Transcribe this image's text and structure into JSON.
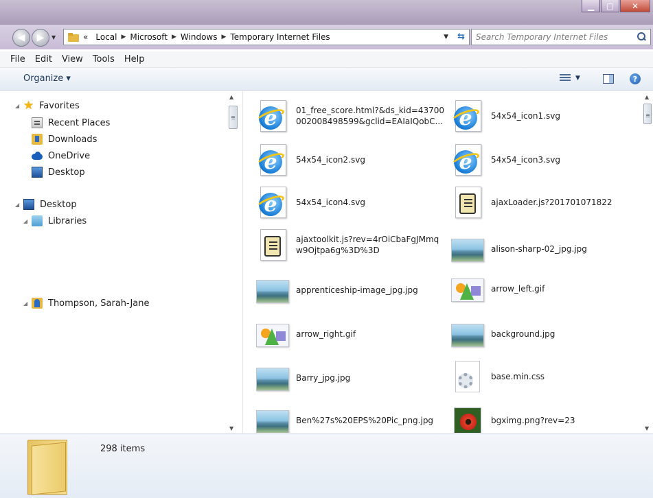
{
  "window": {
    "caption_buttons": [
      "minimize",
      "maximize",
      "close"
    ]
  },
  "address": {
    "crumbs": [
      "«",
      "Local",
      "Microsoft",
      "Windows",
      "Temporary Internet Files"
    ],
    "search_placeholder": "Search Temporary Internet Files"
  },
  "menu": {
    "items": [
      "File",
      "Edit",
      "View",
      "Tools",
      "Help"
    ]
  },
  "toolbar": {
    "organize_label": "Organize ▾"
  },
  "nav": {
    "favorites": "Favorites",
    "recent_places": "Recent Places",
    "downloads": "Downloads",
    "onedrive": "OneDrive",
    "desktop_fav": "Desktop",
    "desktop": "Desktop",
    "libraries": "Libraries",
    "user": "Thompson, Sarah-Jane"
  },
  "files": [
    {
      "name": "01_free_score.html?&ds_kid=43700\n002008498599&gclid=EAIaIQobC...",
      "icon": "ie-document-icon"
    },
    {
      "name": "54x54_icon1.svg",
      "icon": "ie-document-icon"
    },
    {
      "name": "54x54_icon2.svg",
      "icon": "ie-document-icon"
    },
    {
      "name": "54x54_icon3.svg",
      "icon": "ie-document-icon"
    },
    {
      "name": "54x54_icon4.svg",
      "icon": "ie-document-icon"
    },
    {
      "name": "ajaxLoader.js?201701071822",
      "icon": "script-icon"
    },
    {
      "name": "ajaxtoolkit.js?rev=4rOiCbaFgJMmq\nw9Ojtpa6g%3D%3D",
      "icon": "script-icon"
    },
    {
      "name": "alison-sharp-02_jpg.jpg",
      "icon": "landscape-image-icon"
    },
    {
      "name": "apprenticeship-image_jpg.jpg",
      "icon": "landscape-image-icon"
    },
    {
      "name": "arrow_left.gif",
      "icon": "gif-image-icon"
    },
    {
      "name": "arrow_right.gif",
      "icon": "gif-image-icon"
    },
    {
      "name": "background.jpg",
      "icon": "landscape-image-icon"
    },
    {
      "name": "Barry_jpg.jpg",
      "icon": "landscape-image-icon"
    },
    {
      "name": "base.min.css",
      "icon": "css-document-icon"
    },
    {
      "name": "Ben%27s%20EPS%20Pic_png.jpg",
      "icon": "landscape-image-icon"
    },
    {
      "name": "bgximg.png?rev=23",
      "icon": "flower-image-icon"
    }
  ],
  "status": {
    "item_count": "298 items"
  }
}
